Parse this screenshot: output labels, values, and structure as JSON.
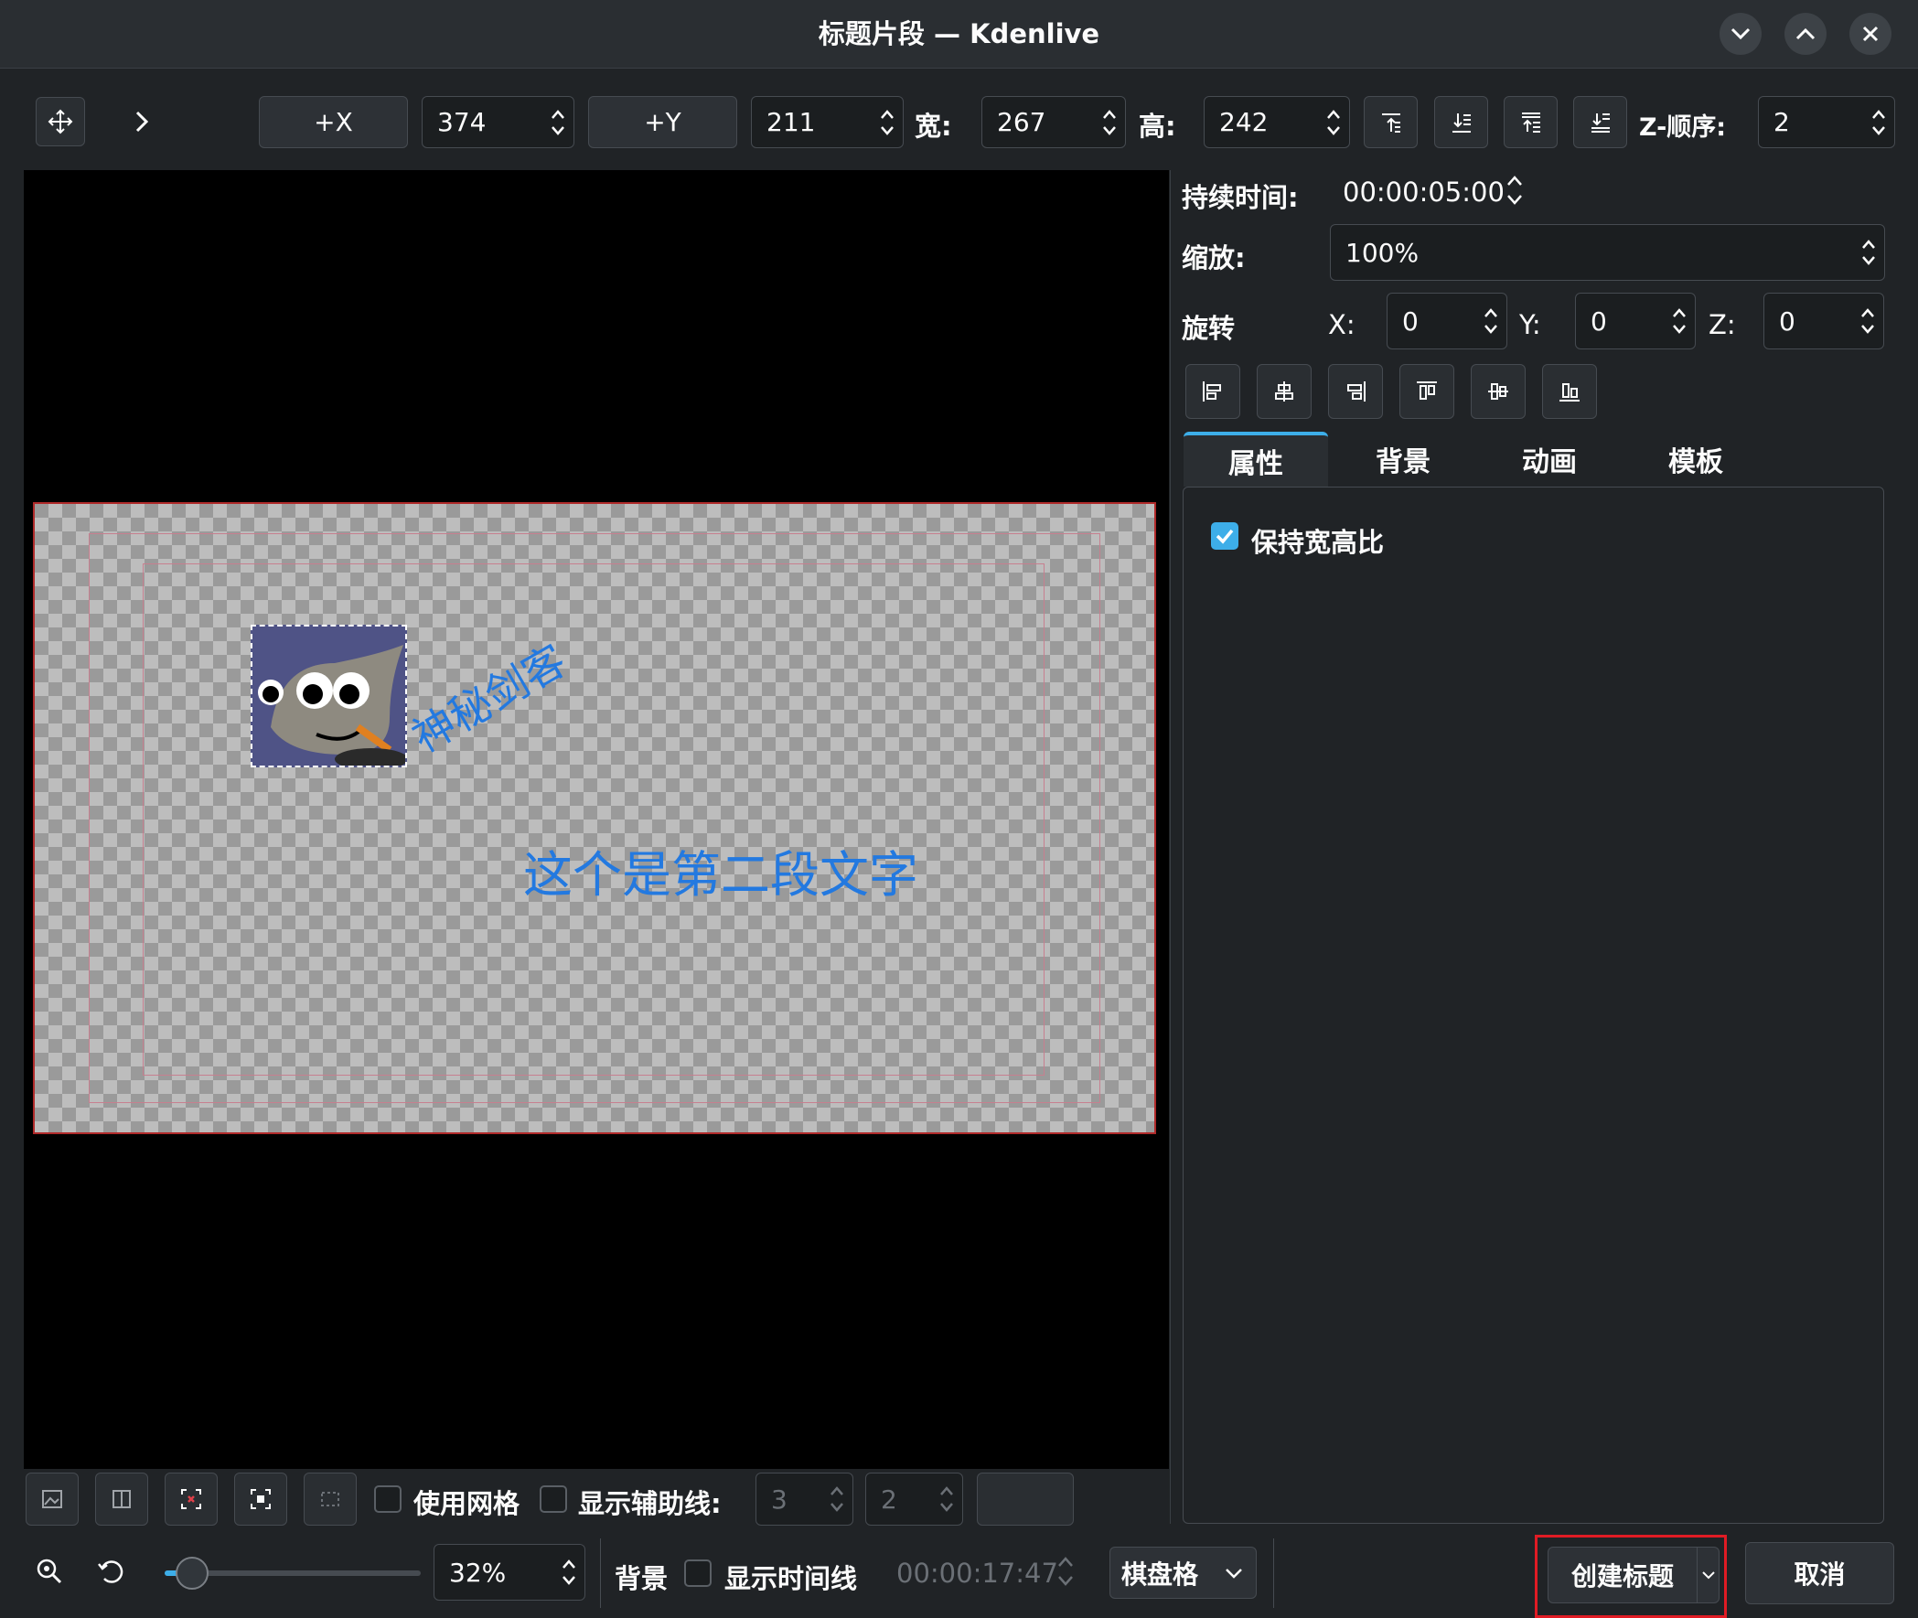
{
  "window": {
    "title": "标题片段 — Kdenlive",
    "controls": [
      "minimize",
      "maximize",
      "close"
    ]
  },
  "toolbar": {
    "x_button": "+X",
    "x_value": "374",
    "y_button": "+Y",
    "y_value": "211",
    "width_label": "宽:",
    "width_value": "267",
    "height_label": "高:",
    "height_value": "242",
    "z_label": "Z-顺序:",
    "z_value": "2"
  },
  "properties": {
    "duration_label": "持续时间:",
    "duration_value": "00:00:05:00",
    "zoom_label": "缩放:",
    "zoom_value": "100%",
    "rotate_label": "旋转",
    "rx_label": "X:",
    "rx_value": "0",
    "ry_label": "Y:",
    "ry_value": "0",
    "rz_label": "Z:",
    "rz_value": "0"
  },
  "tabs": [
    "属性",
    "背景",
    "动画",
    "模板"
  ],
  "tab_content": {
    "keep_aspect_label": "保持宽高比",
    "keep_aspect_checked": true
  },
  "canvas": {
    "text1": "神秘剑客",
    "text2": "这个是第二段文字",
    "text_color": "#2379e0"
  },
  "canvas_toolbar": {
    "use_grid_label": "使用网格",
    "show_guides_label": "显示辅助线:",
    "guides_h": "3",
    "guides_v": "2"
  },
  "bottom": {
    "zoom_value": "32%",
    "zoom_fraction": 0.05,
    "background_label": "背景",
    "show_timeline_label": "显示时间线",
    "timecode": "00:00:17:47",
    "background_mode": "棋盘格",
    "create_button": "创建标题",
    "cancel_button": "取消"
  },
  "colors": {
    "accent": "#3daee9",
    "highlight": "#e01b24"
  }
}
